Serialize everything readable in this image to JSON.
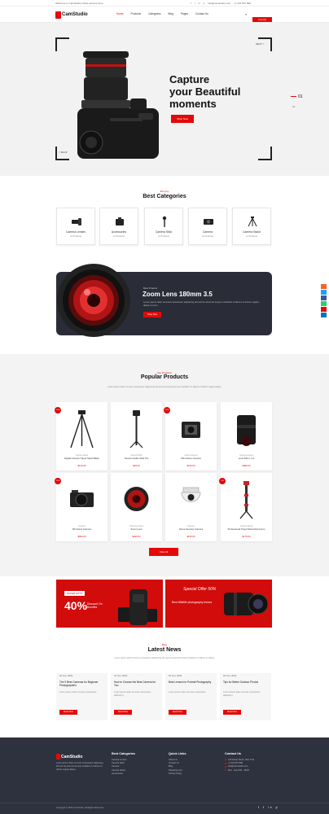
{
  "topbar": {
    "welcome": "Welcome to CamStudio online camera store",
    "links": [
      "f",
      "t",
      "in",
      "p",
      "info@camstudio.com",
      "+1 234 567 890"
    ]
  },
  "nav": {
    "logo": "CamStudio",
    "items": [
      "Home",
      "Products",
      "Categories",
      "Blog",
      "Pages",
      "Contact Us"
    ],
    "cart_label": "Cart (0)"
  },
  "hero": {
    "title_line1": "Capture",
    "title_line2": "your Beautiful",
    "title_line3": "moments",
    "button": "Shop Now",
    "prev": "< BACK",
    "next": "NEXT >",
    "current": "01",
    "next_index": "02"
  },
  "categories": {
    "sub": "Shop by",
    "title": "Best Categories",
    "items": [
      {
        "label": "Camera Lenses",
        "count": "12 Products"
      },
      {
        "label": "Accessories",
        "count": "12 Products"
      },
      {
        "label": "Camera Stick",
        "count": "12 Products"
      },
      {
        "label": "Camera",
        "count": "12 Products"
      },
      {
        "label": "Camera Stand",
        "count": "12 Products"
      }
    ]
  },
  "lens_banner": {
    "sub": "Best Product",
    "title": "Zoom Lens 180mm 3.5",
    "desc": "Lorem ipsum dolor sit amet consectetur adipiscing elit sed do eiusmod tempor incididunt ut labore et dolore magna aliqua ut enim.",
    "button": "Shop Now"
  },
  "popular": {
    "sub": "Our Products",
    "title": "Popular Products",
    "desc": "Lorem ipsum dolor sit amet consectetur adipiscing elit sed do eiusmod tempor incididunt ut labore et dolore magna aliqua.",
    "products": [
      {
        "badge": "-10%",
        "cat": "Camera Stand",
        "name": "Digital Camera Tripod Stand Black",
        "price": "$120.00"
      },
      {
        "badge": "",
        "cat": "Camera Stick",
        "name": "Camera Selfie Stick Pro",
        "price": "$45.00"
      },
      {
        "badge": "-15%",
        "cat": "Action Camera",
        "name": "Mini Action Camera",
        "price": "$210.00"
      },
      {
        "badge": "",
        "cat": "Camera Lenses",
        "name": "Lens 50mm 1.4",
        "price": "$380.00"
      },
      {
        "badge": "-20%",
        "cat": "Camera",
        "name": "Mirrorless Camera",
        "price": "$650.00"
      },
      {
        "badge": "",
        "cat": "Camera Lenses",
        "name": "Zoom Lens",
        "price": "$290.00"
      },
      {
        "badge": "",
        "cat": "Camera",
        "name": "Dome Security Camera",
        "price": "$150.00"
      },
      {
        "badge": "-5%",
        "cat": "Camera Stand",
        "name": "Professional Tripod Stand Aluminium",
        "price": "$175.00"
      }
    ],
    "view_all": "View All"
  },
  "promos": {
    "left_tag": "OFFER UPTO",
    "left_big": "40%",
    "left_text": "Discount On Bundles",
    "right_title": "Special Offer 50%",
    "right_text": "Best Wildlife photography lenses"
  },
  "news": {
    "sub": "Blog",
    "title": "Latest News",
    "desc": "Lorem ipsum dolor sit amet consectetur adipiscing elit sed do eiusmod tempor incididunt ut labore et dolore.",
    "items": [
      {
        "date": "10 Jan, 2023",
        "title": "The 9 Best Cameras for Beginner Photographers",
        "excerpt": "Lorem ipsum dolor sit amet consectetur.",
        "more": "Read More"
      },
      {
        "date": "12 Jan, 2023",
        "title": "How to Choose the Best Camera for You",
        "excerpt": "Lorem ipsum dolor sit amet consectetur adipiscing.",
        "more": "Read More"
      },
      {
        "date": "15 Jan, 2023",
        "title": "Best Lenses for Portrait Photography",
        "excerpt": "Lorem ipsum dolor sit amet consectetur.",
        "more": "Read More"
      },
      {
        "date": "18 Jan, 2023",
        "title": "Tips for Better Outdoor Photos",
        "excerpt": "Lorem ipsum dolor sit amet consectetur adipiscing.",
        "more": "Read More"
      }
    ]
  },
  "footer": {
    "logo": "CamStudio",
    "about": "Lorem ipsum dolor sit amet consectetur adipiscing elit sed do eiusmod tempor incididunt ut labore et dolore magna aliqua.",
    "col1_title": "Best Categories",
    "col1": [
      "Camera Lenses",
      "Camera Stick",
      "Camera",
      "Camera Stand",
      "Accessories"
    ],
    "col2_title": "Quick Links",
    "col2": [
      "About Us",
      "Contact Us",
      "Blog",
      "Shopping Cart",
      "Privacy Policy"
    ],
    "col3_title": "Contact Us",
    "col3": [
      "123 Street Name, New York",
      "+1 234 567 890",
      "info@camstudio.com",
      "Mon - Sat 9:00 - 18:00"
    ],
    "copyright": "Copyright © 2023 CamStudio. All Rights Reserved.",
    "social": "f t in p"
  },
  "colors": {
    "accent": "#e30a0a",
    "dark": "#2a2d37",
    "footer": "#2e323f"
  }
}
